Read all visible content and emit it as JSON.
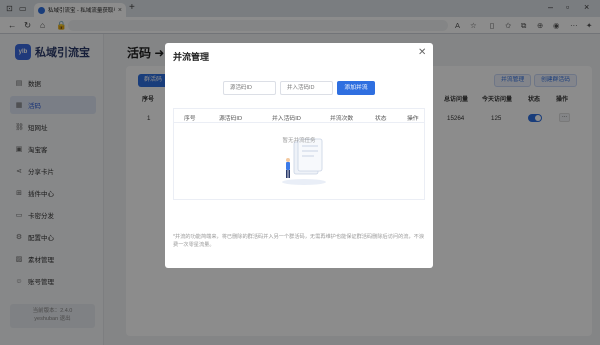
{
  "browser": {
    "tab_title": "私域引流宝 - 私域流量获取与转化",
    "url": "",
    "colors": {
      "accent": "#2f6fe0",
      "overlay": "rgba(0,0,0,0.45)"
    }
  },
  "app": {
    "logo_badge": "ylb",
    "logo_name": "私域引流宝",
    "nav": [
      {
        "label": "数据",
        "icon": "chart-icon"
      },
      {
        "label": "活码",
        "icon": "qrcode-icon",
        "active": true
      },
      {
        "label": "短网址",
        "icon": "link-icon"
      },
      {
        "label": "淘宝客",
        "icon": "store-icon"
      },
      {
        "label": "分享卡片",
        "icon": "share-icon"
      },
      {
        "label": "插件中心",
        "icon": "plugin-icon"
      },
      {
        "label": "卡密分发",
        "icon": "key-icon"
      },
      {
        "label": "配置中心",
        "icon": "gear-icon"
      },
      {
        "label": "素材管理",
        "icon": "image-icon"
      },
      {
        "label": "账号管理",
        "icon": "user-icon"
      }
    ],
    "version_label": "当前版本：2.4.0",
    "user_label": "yeshuban 退出"
  },
  "main": {
    "title": "活码 ➜",
    "create_button": "群活码",
    "merge_button": "并流管理",
    "create_group_button": "创建群活码",
    "headers": [
      "序号",
      "总访问量",
      "今天访问量",
      "状态",
      "操作"
    ],
    "row": {
      "index": "1",
      "total_visits": "15264",
      "today_visits": "125",
      "more": "..."
    }
  },
  "modal": {
    "title": "并流管理",
    "close_icon": "close-icon",
    "input1_placeholder": "源活码ID",
    "input2_placeholder": "并入活码ID",
    "add_button": "添加并流",
    "headers": [
      "序号",
      "源活码ID",
      "并入活码ID",
      "并流次数",
      "状态",
      "操作"
    ],
    "empty_text": "暂无并流任务",
    "note": "*并流的功能简端来，将已删除的群活码并入另一个群活码，无需再维护也能保证群活码删除后访问的流，不浪费一次零星流量。"
  }
}
